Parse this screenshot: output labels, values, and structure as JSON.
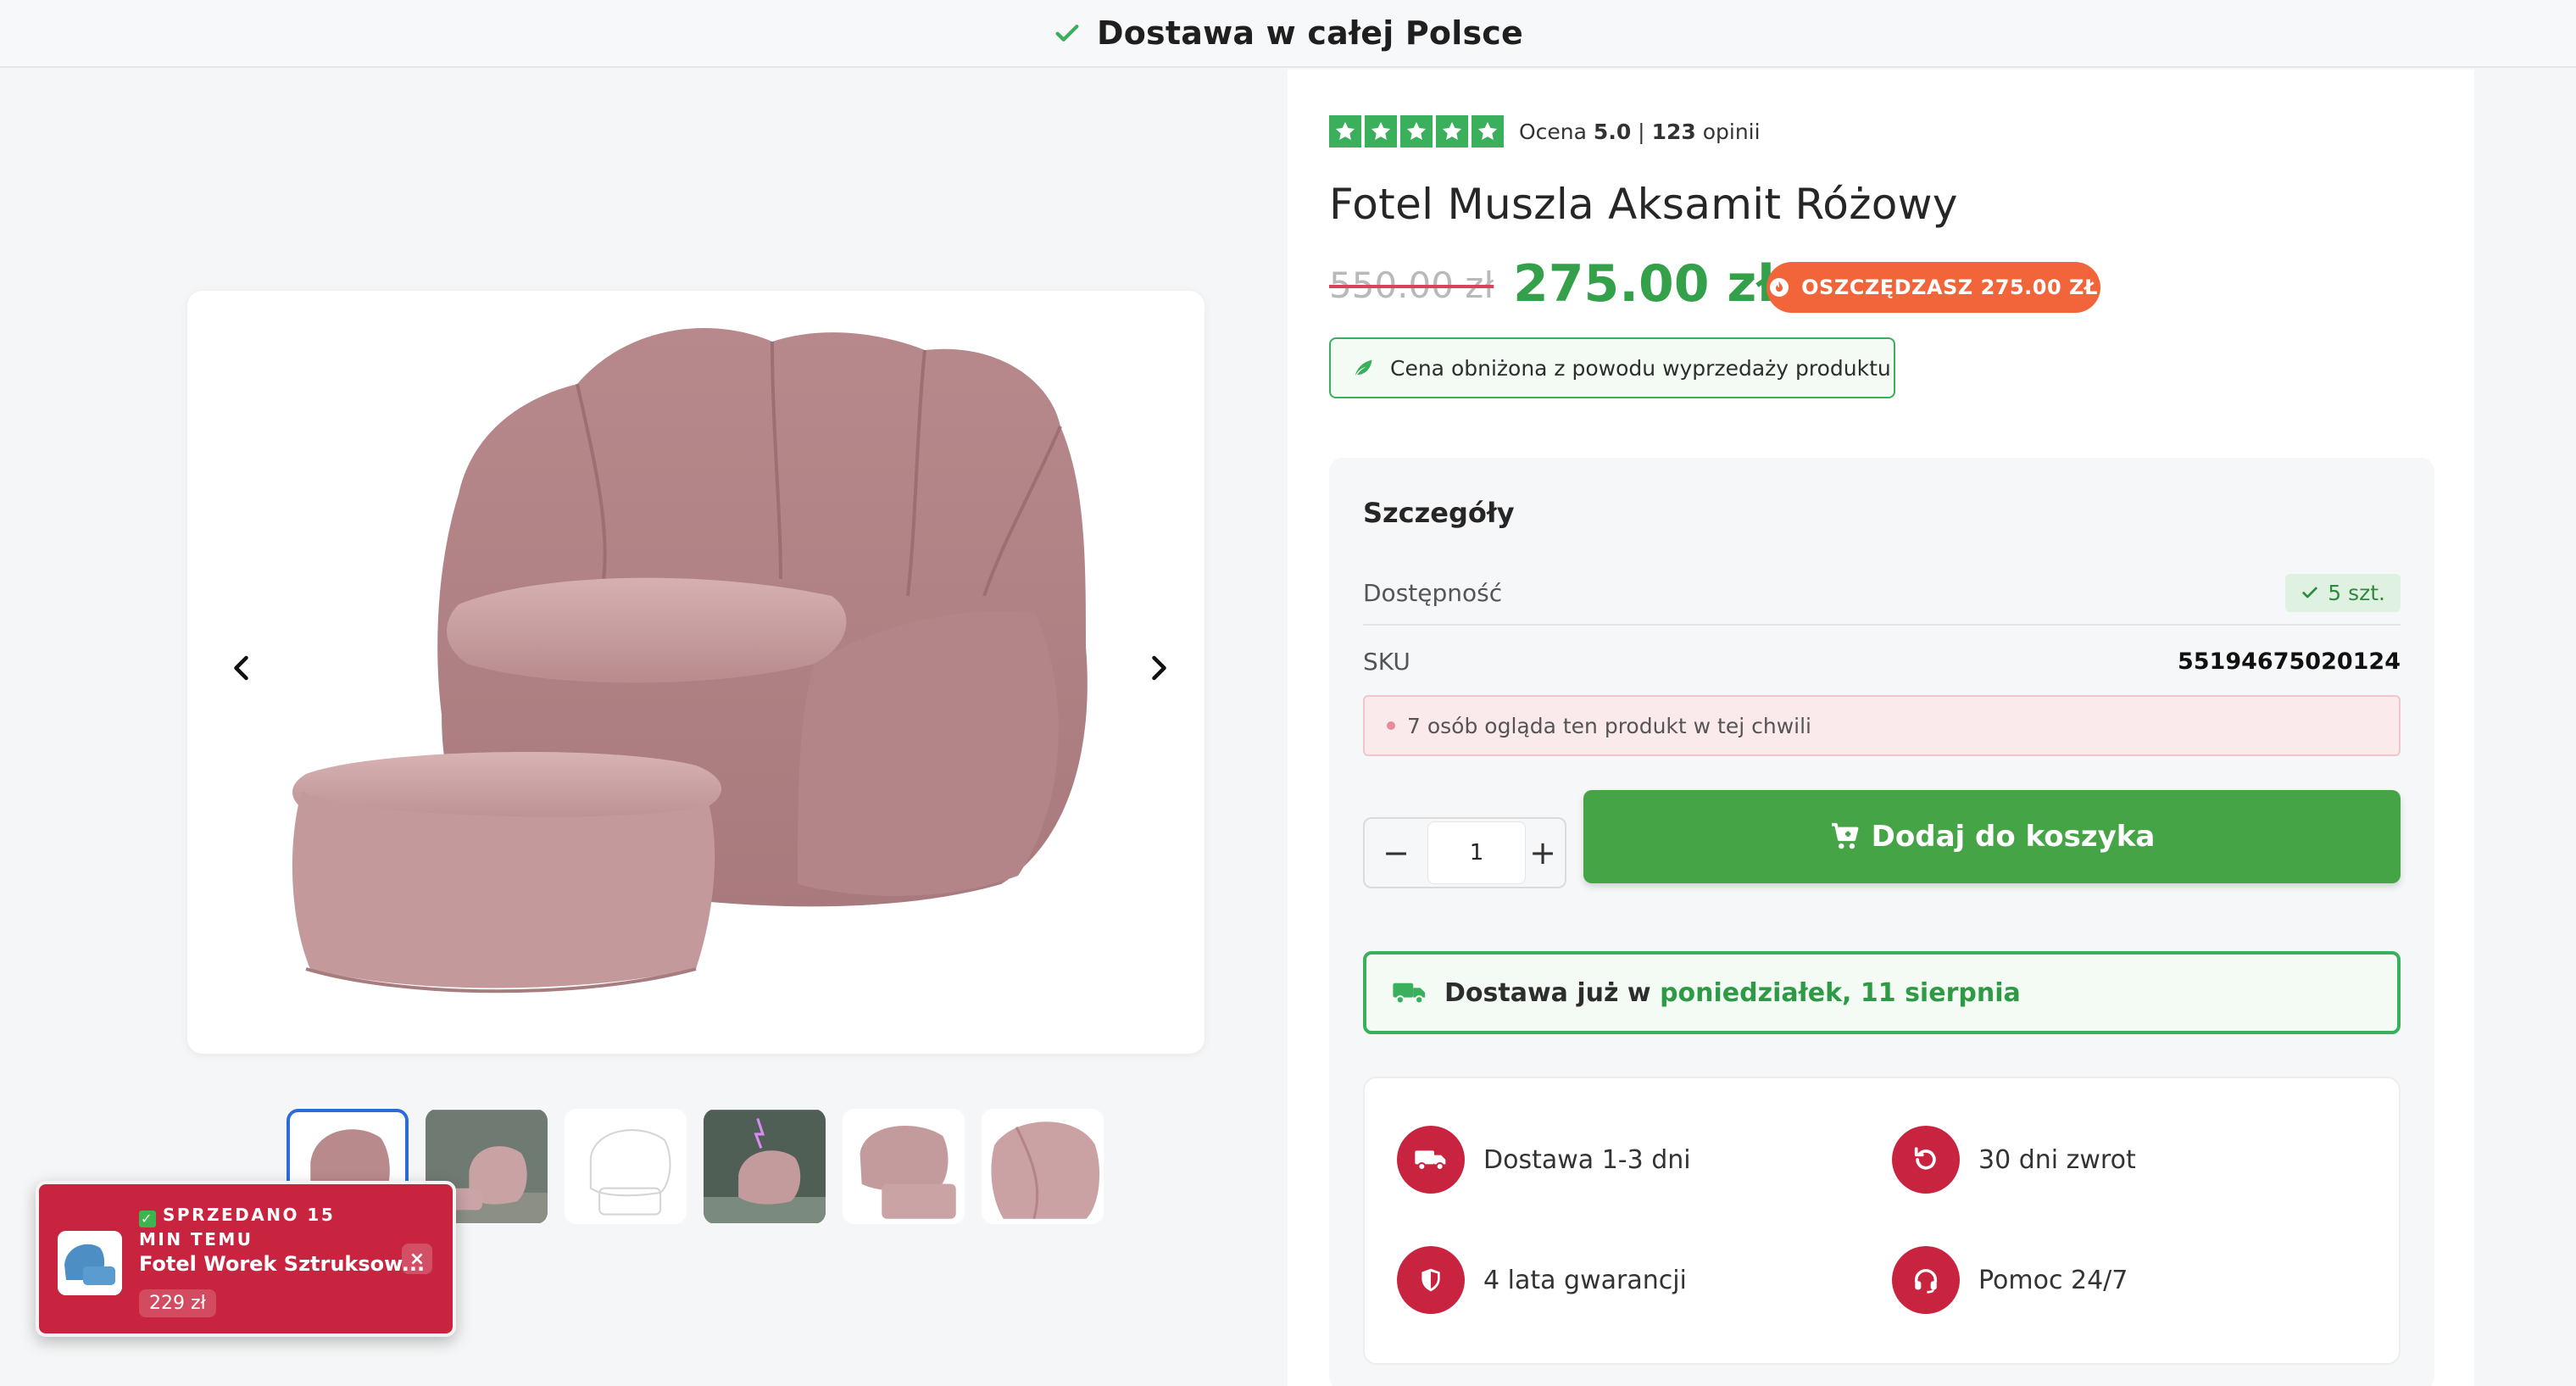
{
  "banner": {
    "text": "Dostawa w całej Polsce",
    "icon": "check-icon"
  },
  "rating": {
    "stars": 5,
    "label": "Ocena",
    "score": "5.0",
    "separator": "|",
    "count": "123",
    "count_label": "opinii"
  },
  "product": {
    "title": "Fotel Muszla Aksamit Różowy",
    "old_price": "550.00 zł",
    "price": "275.00 zł",
    "save_badge": "OSZCZĘDZASZ 275.00 ZŁ",
    "reduced_note": "Cena obniżona z powodu wyprzedaży produktu"
  },
  "details": {
    "title": "Szczegóły",
    "availability_label": "Dostępność",
    "availability_value": "5 szt.",
    "sku_label": "SKU",
    "sku_value": "55194675020124",
    "watching": "7 osób ogląda ten produkt w tej chwili"
  },
  "cart": {
    "quantity": "1",
    "minus": "−",
    "plus": "+",
    "add_label": "Dodaj do koszyka"
  },
  "delivery": {
    "prefix": "Dostawa już w",
    "date": "poniedziałek, 11 sierpnia"
  },
  "features": [
    {
      "label": "Dostawa 1-3 dni",
      "icon": "truck-icon"
    },
    {
      "label": "30 dni zwrot",
      "icon": "return-icon"
    },
    {
      "label": "4 lata gwarancji",
      "icon": "shield-icon"
    },
    {
      "label": "Pomoc 24/7",
      "icon": "headset-icon"
    }
  ],
  "sold_popup": {
    "badge": "SPRZEDANO 15 MIN TEMU",
    "product": "Fotel Worek Sztruksow...",
    "price": "229 zł",
    "close": "×"
  },
  "gallery": {
    "thumbnail_count": 6,
    "active_index": 0
  },
  "colors": {
    "green": "#3aaf5c",
    "price_green": "#34a04a",
    "red": "#c9243f",
    "orange": "#f2653b",
    "pink_fabric": "#c79a9c"
  }
}
